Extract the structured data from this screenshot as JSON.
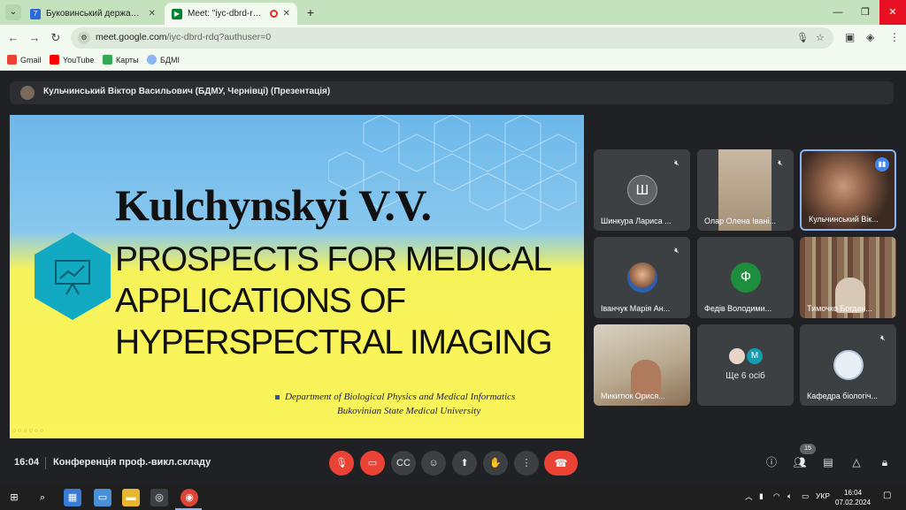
{
  "browser": {
    "tabs": [
      {
        "title": "Буковинський державний ме..."
      },
      {
        "title": "Meet: \"iyc-dbrd-rdq\""
      }
    ],
    "url_host": "meet.google.com",
    "url_path": "/iyc-dbrd-rdq?authuser=0",
    "bookmarks": [
      {
        "label": "Gmail"
      },
      {
        "label": "YouTube"
      },
      {
        "label": "Карты"
      },
      {
        "label": "БДМІ"
      }
    ]
  },
  "meet": {
    "presenter_label": "Кульчинський Віктор Васильович (БДМУ, Чернівці) (Презентація)",
    "slide": {
      "name": "Kulchynskyi V.V.",
      "title_lines": [
        "PROSPECTS FOR MEDICAL",
        "APPLICATIONS OF",
        "HYPERSPECTRAL IMAGING"
      ],
      "dept_line1": "Department of Biological Physics and Medical Informatics",
      "dept_line2": "Bukovinian State Medical University"
    },
    "participants": [
      {
        "name": "Шинкура Лариса ...",
        "initial": "Ш",
        "color": "#5f6368"
      },
      {
        "name": "Олар Олена Івані..."
      },
      {
        "name": "Кульчинський Вік..."
      },
      {
        "name": "Іванчук Марія Ан..."
      },
      {
        "name": "Федів Володими...",
        "initial": "Ф",
        "color": "#1e8e3e"
      },
      {
        "name": "Тимочко Богдан..."
      },
      {
        "name": "Микитюк Орися..."
      },
      {
        "more": "Ще 6 осіб",
        "initial": "М",
        "color": "#129eaf"
      },
      {
        "name": "Кафедра біологіч..."
      }
    ],
    "time": "16:04",
    "meeting_title": "Конференція проф.-викл.складу",
    "participant_count": "15"
  },
  "taskbar": {
    "lang": "УКР",
    "clock_time": "16:04",
    "clock_date": "07.02.2024"
  }
}
